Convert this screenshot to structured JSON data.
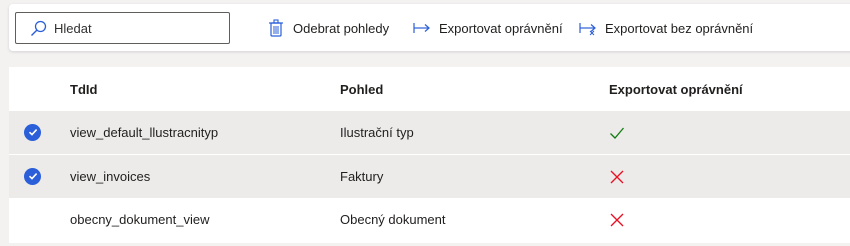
{
  "toolbar": {
    "search": {
      "placeholder": "Hledat",
      "value": ""
    },
    "remove_views_label": "Odebrat pohledy",
    "export_permissions_label": "Exportovat oprávnění",
    "export_without_permissions_label": "Exportovat bez oprávnění"
  },
  "grid": {
    "columns": [
      "TdId",
      "Pohled",
      "Exportovat oprávnění"
    ],
    "rows": [
      {
        "id": "view_default_llustracnityp",
        "view": "Ilustrační typ",
        "export_permissions": "check",
        "selected": true
      },
      {
        "id": "view_invoices",
        "view": "Faktury",
        "export_permissions": "cross",
        "selected": true
      },
      {
        "id": "obecny_dokument_view",
        "view": "Obecný dokument",
        "export_permissions": "cross",
        "selected": false
      }
    ]
  },
  "colors": {
    "accent": "#2b5fd9",
    "check": "#107c10",
    "cross": "#e81123",
    "selected_row": "#edebe9"
  }
}
